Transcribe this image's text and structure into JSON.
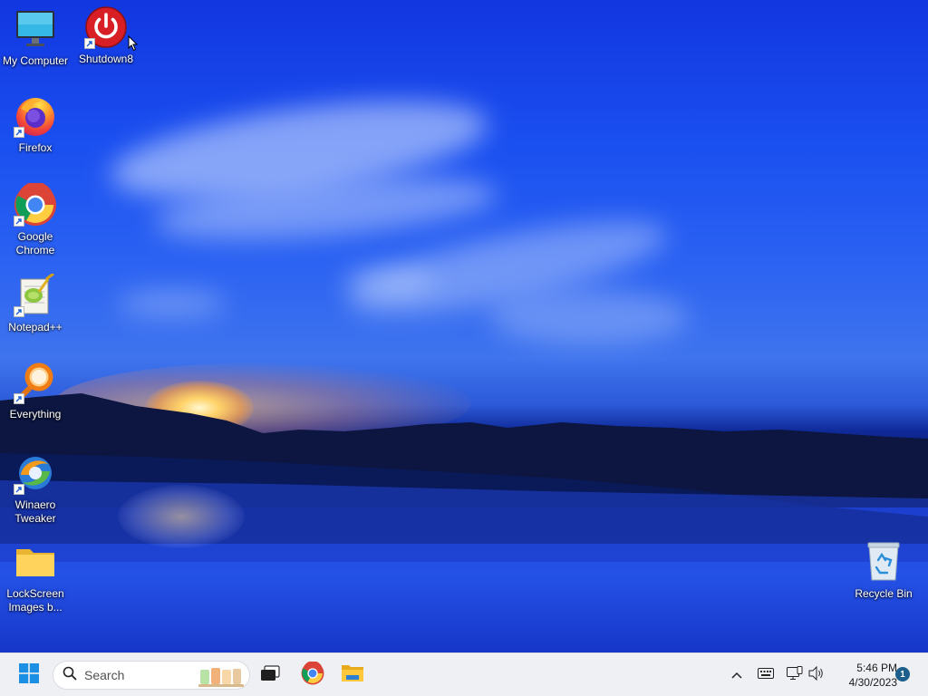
{
  "desktop": {
    "icons": [
      {
        "label": "My Computer",
        "icon": "monitor-icon"
      },
      {
        "label": "Shutdown8",
        "icon": "power-icon"
      },
      {
        "label": "Firefox",
        "icon": "firefox-icon"
      },
      {
        "label": "Google Chrome",
        "icon": "chrome-icon"
      },
      {
        "label": "Notepad++",
        "icon": "notepad-plus-plus-icon"
      },
      {
        "label": "Everything",
        "icon": "magnifier-icon"
      },
      {
        "label": "Winaero Tweaker",
        "icon": "winaero-tweaker-icon"
      },
      {
        "label": "LockScreen Images b...",
        "icon": "folder-icon"
      },
      {
        "label": "Recycle Bin",
        "icon": "recycle-bin-icon"
      }
    ]
  },
  "taskbar": {
    "start_icon": "windows-logo-icon",
    "search_placeholder": "Search",
    "pinned": [
      "task-view-icon",
      "chrome-icon",
      "file-explorer-icon"
    ],
    "tray": [
      "chevron-up-icon",
      "keyboard-icon",
      "network-icon",
      "speaker-icon"
    ],
    "time": "5:46 PM",
    "date": "4/30/2023",
    "notification_count": "1"
  },
  "colors": {
    "taskbar_bg": "#eef0f4",
    "accent": "#1c5f8a",
    "wallpaper_sky": "#1a4ff0"
  }
}
